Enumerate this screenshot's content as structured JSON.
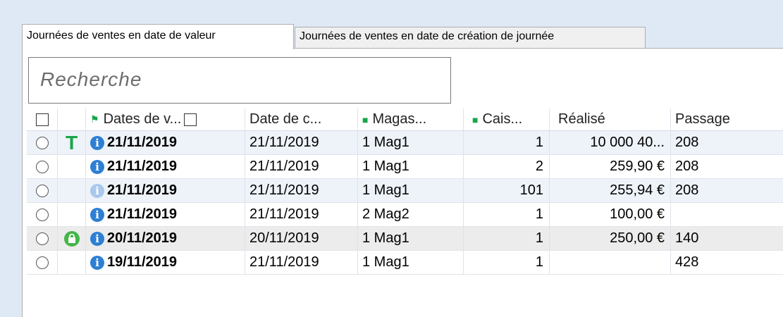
{
  "tabs": [
    {
      "label": "Journées de ventes en date de valeur",
      "active": true
    },
    {
      "label": "Journées de ventes en date de création de journée",
      "active": false
    }
  ],
  "search": {
    "placeholder": "Recherche"
  },
  "table": {
    "columns": [
      "Dates de v...",
      "Date de c...",
      "Magas...",
      "Cais...",
      "Réalisé",
      "Passage"
    ],
    "rows": [
      {
        "marker": "T",
        "info": "active",
        "date_valeur": "21/11/2019",
        "date_creation": "21/11/2019",
        "magasin": "1 Mag1",
        "caisse": "1",
        "realise": "10 000 40...",
        "passage": "208"
      },
      {
        "marker": "",
        "info": "active",
        "date_valeur": "21/11/2019",
        "date_creation": "21/11/2019",
        "magasin": "1 Mag1",
        "caisse": "2",
        "realise": "259,90 €",
        "passage": "208"
      },
      {
        "marker": "",
        "info": "faded",
        "date_valeur": "21/11/2019",
        "date_creation": "21/11/2019",
        "magasin": "1 Mag1",
        "caisse": "101",
        "realise": "255,94 €",
        "passage": "208"
      },
      {
        "marker": "",
        "info": "active",
        "date_valeur": "21/11/2019",
        "date_creation": "21/11/2019",
        "magasin": "2 Mag2",
        "caisse": "1",
        "realise": "100,00 €",
        "passage": ""
      },
      {
        "marker": "lock",
        "info": "active",
        "date_valeur": "20/11/2019",
        "date_creation": "20/11/2019",
        "magasin": "1 Mag1",
        "caisse": "1",
        "realise": "250,00 €",
        "passage": "140"
      },
      {
        "marker": "",
        "info": "active",
        "date_valeur": "19/11/2019",
        "date_creation": "21/11/2019",
        "magasin": "1 Mag1",
        "caisse": "1",
        "realise": "",
        "passage": "428"
      }
    ]
  },
  "colors": {
    "accent": "#2d7fd3",
    "green": "#1aa54a"
  },
  "icons": {
    "marker_T": "T",
    "lock": "lock-icon",
    "info": "info-icon"
  }
}
